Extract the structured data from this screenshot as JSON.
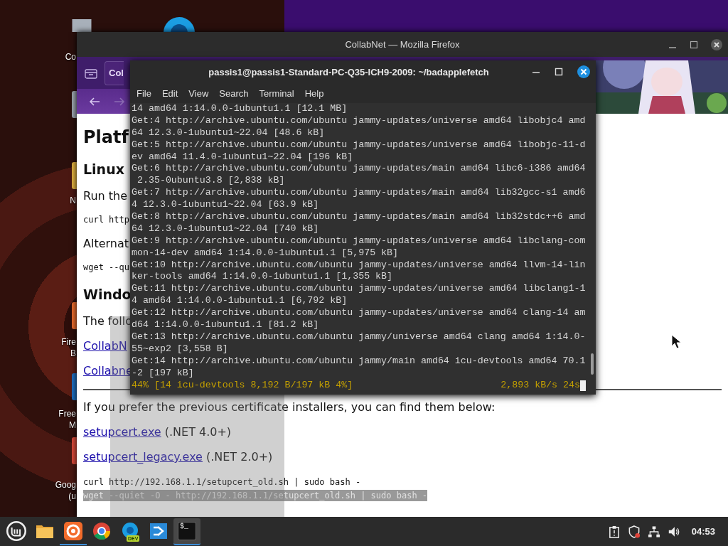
{
  "desktop": {
    "icons": [
      {
        "lines": [
          "Co"
        ],
        "color": "#9aa3ad"
      },
      {
        "lines": [
          "N"
        ],
        "color": "#e0b040"
      },
      {
        "lines": [
          "Fire",
          "B"
        ],
        "color": "#e86a2c"
      },
      {
        "lines": [
          "Free",
          "M"
        ],
        "color": "#1f6fc0"
      },
      {
        "lines": [
          "Goog",
          "(u"
        ],
        "color": "#d94a3a"
      }
    ]
  },
  "firefox": {
    "title": "CollabNet — Mozilla Firefox",
    "tab": "Col",
    "page": [
      {
        "kind": "h1",
        "text": "Platf"
      },
      {
        "kind": "h2",
        "text": "Linux"
      },
      {
        "kind": "p",
        "text": "Run the"
      },
      {
        "kind": "code",
        "text": "curl http"
      },
      {
        "kind": "p",
        "text": "Alternat"
      },
      {
        "kind": "code",
        "text": "wget --qu"
      },
      {
        "kind": "h2",
        "text": "Windo"
      },
      {
        "kind": "p",
        "text": "The follo"
      },
      {
        "kind": "link",
        "text": "CollabN"
      },
      {
        "kind": "link",
        "text": "Collabne"
      },
      {
        "kind": "hr"
      },
      {
        "kind": "p",
        "text": "If you prefer the previous certificate installers, you can find them below:"
      },
      {
        "kind": "linknote",
        "link": "setupcert.exe",
        "note": "(.NET 4.0+)"
      },
      {
        "kind": "linknote",
        "link": "setupcert_legacy.exe",
        "note": "(.NET 2.0+)"
      },
      {
        "kind": "codeblock",
        "lines": [
          {
            "text": "curl http://192.168.1.1/setupcert_old.sh | sudo bash -",
            "selected": false
          },
          {
            "text": "wget --quiet -O - http://192.168.1.1/setupcert_old.sh | sudo bash -",
            "selected": true
          }
        ]
      }
    ]
  },
  "terminal": {
    "title": "passis1@passis1-Standard-PC-Q35-ICH9-2009: ~/badapplefetch",
    "menu": [
      "File",
      "Edit",
      "View",
      "Search",
      "Terminal",
      "Help"
    ],
    "lines": [
      "14 amd64 1:14.0.0-1ubuntu1.1 [12.1 MB]",
      "Get:4 http://archive.ubuntu.com/ubuntu jammy-updates/universe amd64 libobjc4 amd",
      "64 12.3.0-1ubuntu1~22.04 [48.6 kB]",
      "Get:5 http://archive.ubuntu.com/ubuntu jammy-updates/universe amd64 libobjc-11-d",
      "ev amd64 11.4.0-1ubuntu1~22.04 [196 kB]",
      "Get:6 http://archive.ubuntu.com/ubuntu jammy-updates/main amd64 libc6-i386 amd64",
      " 2.35-0ubuntu3.8 [2,838 kB]",
      "Get:7 http://archive.ubuntu.com/ubuntu jammy-updates/main amd64 lib32gcc-s1 amd6",
      "4 12.3.0-1ubuntu1~22.04 [63.9 kB]",
      "Get:8 http://archive.ubuntu.com/ubuntu jammy-updates/main amd64 lib32stdc++6 amd",
      "64 12.3.0-1ubuntu1~22.04 [740 kB]",
      "Get:9 http://archive.ubuntu.com/ubuntu jammy-updates/universe amd64 libclang-com",
      "mon-14-dev amd64 1:14.0.0-1ubuntu1.1 [5,975 kB]",
      "Get:10 http://archive.ubuntu.com/ubuntu jammy-updates/universe amd64 llvm-14-lin",
      "ker-tools amd64 1:14.0.0-1ubuntu1.1 [1,355 kB]",
      "Get:11 http://archive.ubuntu.com/ubuntu jammy-updates/universe amd64 libclang1-1",
      "4 amd64 1:14.0.0-1ubuntu1.1 [6,792 kB]",
      "Get:12 http://archive.ubuntu.com/ubuntu jammy-updates/universe amd64 clang-14 am",
      "d64 1:14.0.0-1ubuntu1.1 [81.2 kB]",
      "Get:13 http://archive.ubuntu.com/ubuntu jammy/universe amd64 clang amd64 1:14.0-",
      "55~exp2 [3,558 B]",
      "Get:14 http://archive.ubuntu.com/ubuntu jammy/main amd64 icu-devtools amd64 70.1",
      "-2 [197 kB]"
    ],
    "progress": "44% [14 icu-devtools 8,192 B/197 kB 4%]",
    "speed": "2,893 kB/s 24s"
  },
  "taskbar": {
    "apps": [
      {
        "kind": "folder",
        "running": false,
        "selected": false
      },
      {
        "kind": "firefox",
        "running": true,
        "selected": false
      },
      {
        "kind": "chrome",
        "running": false,
        "selected": false
      },
      {
        "kind": "edge",
        "badge": "DEV",
        "running": false,
        "selected": false
      },
      {
        "kind": "remote",
        "running": false,
        "selected": false
      },
      {
        "kind": "terminal",
        "glyph": "$_",
        "running": true,
        "selected": true
      }
    ],
    "clock": "04:53"
  }
}
